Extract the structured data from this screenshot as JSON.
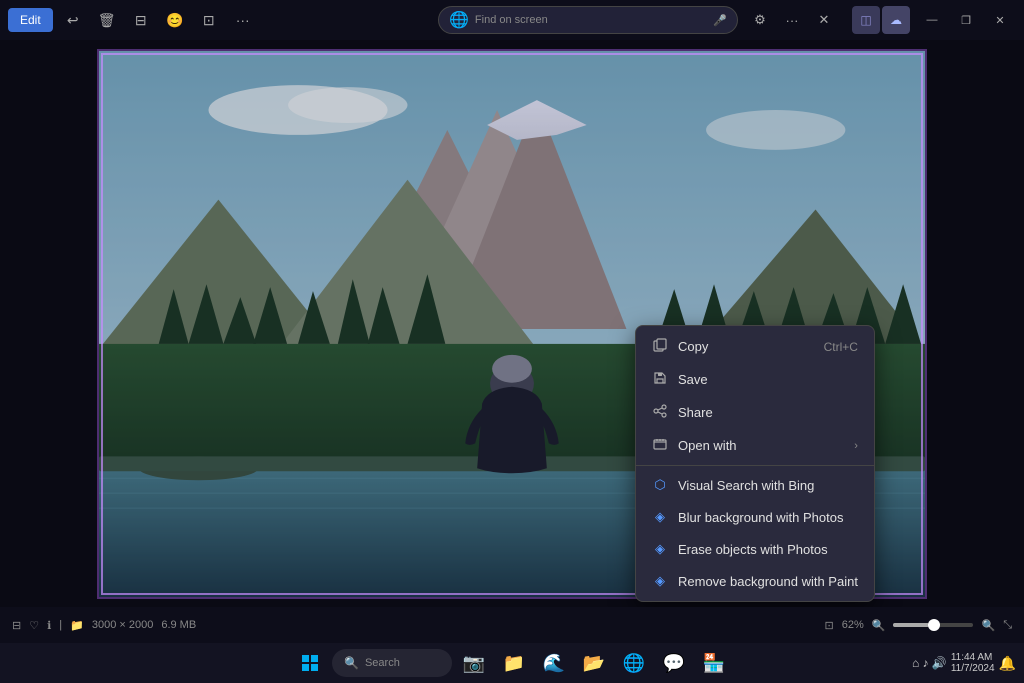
{
  "titlebar": {
    "edit_label": "Edit",
    "icons": [
      "↩",
      "🗑",
      "⊖",
      "😊",
      "⊡",
      "···"
    ]
  },
  "browser": {
    "address_placeholder": "Find on screen",
    "icons": [
      "⚙",
      "···",
      "✕"
    ]
  },
  "top_right": {
    "icons": [
      "□",
      "☁"
    ]
  },
  "window_controls": {
    "minimize": "—",
    "maximize": "❐",
    "close": "✕"
  },
  "context_menu": {
    "items": [
      {
        "id": "copy",
        "icon": "copy",
        "label": "Copy",
        "shortcut": "Ctrl+C"
      },
      {
        "id": "save",
        "icon": "save",
        "label": "Save",
        "shortcut": ""
      },
      {
        "id": "share",
        "icon": "share",
        "label": "Share",
        "shortcut": ""
      },
      {
        "id": "open-with",
        "icon": "open",
        "label": "Open with",
        "has_arrow": true
      },
      {
        "id": "sep1",
        "type": "separator"
      },
      {
        "id": "visual-search",
        "icon": "bing",
        "label": "Visual Search with Bing",
        "shortcut": ""
      },
      {
        "id": "blur-bg",
        "icon": "photos",
        "label": "Blur background with Photos",
        "shortcut": ""
      },
      {
        "id": "erase",
        "icon": "photos",
        "label": "Erase objects with Photos",
        "shortcut": ""
      },
      {
        "id": "remove-bg",
        "icon": "paint",
        "label": "Remove background with Paint",
        "shortcut": ""
      }
    ]
  },
  "status_bar": {
    "dimensions": "3000 × 2000",
    "size": "6.9 MB",
    "zoom": "62%",
    "icons": [
      "□",
      "♥",
      "ℹ",
      "📁"
    ]
  },
  "taskbar": {
    "search_placeholder": "Search",
    "apps": [
      "⊞",
      "🔍",
      "📷",
      "📁",
      "🌐",
      "📂",
      "🌍",
      "💬",
      "🏪"
    ]
  }
}
